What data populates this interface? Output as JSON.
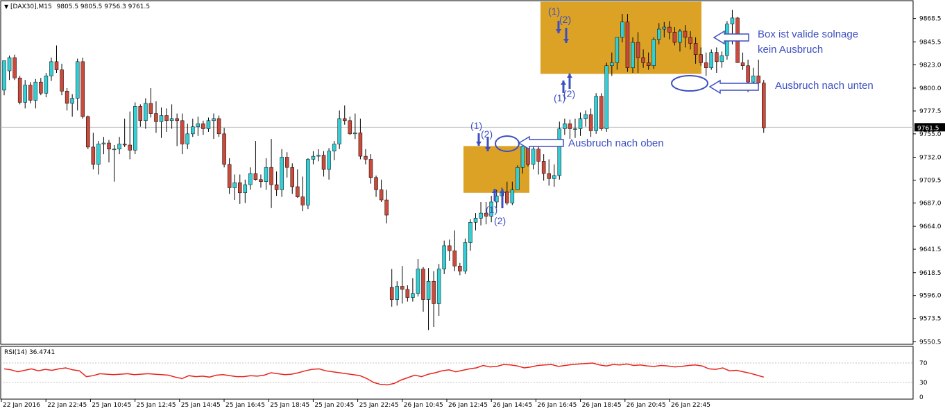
{
  "header": {
    "symbol": "[DAX30],M15",
    "ohlc": "9805.5 9805.5 9756.3 9761.5"
  },
  "rsi": {
    "label": "RSI(14) 36.4741"
  },
  "colors": {
    "bull": "#32cfd6",
    "bear": "#cb4a3b",
    "wick": "#000000",
    "box": "#dba226",
    "annotation": "#3d4fc2",
    "rsi_line": "#e8231c",
    "grid_line": "#c0c0c0"
  },
  "annotations": {
    "box_valid_1": "Box ist valide solnage",
    "box_valid_2": "kein Ausbruch",
    "breakout_down": "Ausbruch nach unten",
    "breakout_up": "Ausbruch nach oben",
    "m1": "(1)",
    "m2": "(2)"
  },
  "chart_data": {
    "type": "candlestick",
    "symbol": "[DAX30]",
    "timeframe": "M15",
    "current_price": "9761.5",
    "price_axis_ticks": [
      "9868.5",
      "9845.5",
      "9823.0",
      "9800.0",
      "9777.5",
      "9755.0",
      "9732.0",
      "9709.5",
      "9687.0",
      "9664.0",
      "9641.5",
      "9618.5",
      "9596.0",
      "9573.5",
      "9550.5"
    ],
    "time_axis_labels": [
      "22 Jan 2016",
      "22 Jan 22:45",
      "25 Jan 10:45",
      "25 Jan 12:45",
      "25 Jan 14:45",
      "25 Jan 16:45",
      "25 Jan 18:45",
      "25 Jan 20:45",
      "25 Jan 22:45",
      "26 Jan 10:45",
      "26 Jan 12:45",
      "26 Jan 14:45",
      "26 Jan 16:45",
      "26 Jan 18:45",
      "26 Jan 20:45",
      "26 Jan 22:45"
    ],
    "ylim": [
      9548,
      9886
    ],
    "candles": [
      [
        9798,
        9827,
        9793,
        9827
      ],
      [
        9817,
        9832,
        9808,
        9830
      ],
      [
        9830,
        9833,
        9808,
        9810
      ],
      [
        9810,
        9812,
        9784,
        9786
      ],
      [
        9786,
        9808,
        9780,
        9803
      ],
      [
        9803,
        9806,
        9785,
        9788
      ],
      [
        9788,
        9809,
        9780,
        9806
      ],
      [
        9806,
        9810,
        9793,
        9795
      ],
      [
        9795,
        9815,
        9791,
        9812
      ],
      [
        9812,
        9830,
        9807,
        9826
      ],
      [
        9826,
        9842,
        9815,
        9818
      ],
      [
        9818,
        9824,
        9793,
        9797
      ],
      [
        9797,
        9800,
        9778,
        9785
      ],
      [
        9785,
        9794,
        9772,
        9790
      ],
      [
        9790,
        9829,
        9778,
        9826
      ],
      [
        9826,
        9830,
        9770,
        9772
      ],
      [
        9772,
        9773,
        9740,
        9742
      ],
      [
        9742,
        9756,
        9720,
        9725
      ],
      [
        9725,
        9748,
        9715,
        9745
      ],
      [
        9745,
        9752,
        9735,
        9746
      ],
      [
        9746,
        9749,
        9727,
        9740
      ],
      [
        9740,
        9744,
        9708,
        9740
      ],
      [
        9740,
        9752,
        9735,
        9745
      ],
      [
        9745,
        9770,
        9742,
        9744
      ],
      [
        9744,
        9777,
        9730,
        9739
      ],
      [
        9739,
        9786,
        9735,
        9782
      ],
      [
        9782,
        9784,
        9762,
        9768
      ],
      [
        9768,
        9790,
        9760,
        9785
      ],
      [
        9785,
        9800,
        9771,
        9775
      ],
      [
        9775,
        9787,
        9756,
        9767
      ],
      [
        9767,
        9781,
        9751,
        9773
      ],
      [
        9773,
        9780,
        9757,
        9768
      ],
      [
        9768,
        9784,
        9760,
        9770
      ],
      [
        9770,
        9775,
        9743,
        9768
      ],
      [
        9768,
        9775,
        9735,
        9745
      ],
      [
        9745,
        9765,
        9740,
        9755
      ],
      [
        9755,
        9770,
        9752,
        9762
      ],
      [
        9762,
        9772,
        9753,
        9765
      ],
      [
        9765,
        9768,
        9754,
        9760
      ],
      [
        9760,
        9771,
        9757,
        9768
      ],
      [
        9768,
        9775,
        9750,
        9770
      ],
      [
        9770,
        9773,
        9752,
        9755
      ],
      [
        9755,
        9761,
        9722,
        9725
      ],
      [
        9725,
        9731,
        9696,
        9702
      ],
      [
        9702,
        9715,
        9690,
        9707
      ],
      [
        9707,
        9715,
        9686,
        9697
      ],
      [
        9697,
        9710,
        9687,
        9705
      ],
      [
        9705,
        9722,
        9700,
        9716
      ],
      [
        9716,
        9748,
        9709,
        9710
      ],
      [
        9710,
        9715,
        9702,
        9708
      ],
      [
        9708,
        9731,
        9700,
        9722
      ],
      [
        9722,
        9750,
        9682,
        9705
      ],
      [
        9705,
        9718,
        9694,
        9700
      ],
      [
        9700,
        9740,
        9693,
        9732
      ],
      [
        9732,
        9737,
        9712,
        9722
      ],
      [
        9722,
        9726,
        9696,
        9703
      ],
      [
        9703,
        9720,
        9692,
        9693
      ],
      [
        9693,
        9713,
        9679,
        9685
      ],
      [
        9685,
        9731,
        9681,
        9730
      ],
      [
        9730,
        9738,
        9725,
        9733
      ],
      [
        9733,
        9740,
        9728,
        9734
      ],
      [
        9734,
        9738,
        9713,
        9720
      ],
      [
        9720,
        9741,
        9710,
        9738
      ],
      [
        9738,
        9748,
        9729,
        9745
      ],
      [
        9745,
        9778,
        9740,
        9770
      ],
      [
        9770,
        9783,
        9764,
        9768
      ],
      [
        9768,
        9772,
        9754,
        9755
      ],
      [
        9755,
        9775,
        9750,
        9756
      ],
      [
        9756,
        9770,
        9730,
        9733
      ],
      [
        9733,
        9740,
        9725,
        9730
      ],
      [
        9730,
        9735,
        9706,
        9712
      ],
      [
        9712,
        9714,
        9693,
        9700
      ],
      [
        9700,
        9710,
        9688,
        9690
      ],
      [
        9690,
        9700,
        9667,
        9675
      ],
      [
        9604,
        9622,
        9585,
        9592
      ],
      [
        9592,
        9610,
        9586,
        9605
      ],
      [
        9605,
        9625,
        9588,
        9602
      ],
      [
        9602,
        9606,
        9590,
        9594
      ],
      [
        9594,
        9613,
        9590,
        9598
      ],
      [
        9598,
        9632,
        9595,
        9622
      ],
      [
        9622,
        9624,
        9580,
        9592
      ],
      [
        9592,
        9623,
        9562,
        9610
      ],
      [
        9610,
        9620,
        9565,
        9588
      ],
      [
        9588,
        9627,
        9576,
        9622
      ],
      [
        9622,
        9650,
        9617,
        9645
      ],
      [
        9645,
        9651,
        9630,
        9640
      ],
      [
        9640,
        9660,
        9620,
        9625
      ],
      [
        9625,
        9628,
        9616,
        9620
      ],
      [
        9620,
        9652,
        9617,
        9648
      ],
      [
        9648,
        9671,
        9640,
        9668
      ],
      [
        9668,
        9677,
        9660,
        9672
      ],
      [
        9672,
        9688,
        9665,
        9677
      ],
      [
        9677,
        9688,
        9666,
        9674
      ],
      [
        9674,
        9694,
        9668,
        9688
      ],
      [
        9688,
        9700,
        9682,
        9694
      ],
      [
        9694,
        9702,
        9688,
        9698
      ],
      [
        9698,
        9708,
        9685,
        9687
      ],
      [
        9687,
        9708,
        9685,
        9700
      ],
      [
        9700,
        9724,
        9700,
        9722
      ],
      [
        9722,
        9747,
        9716,
        9743
      ],
      [
        9743,
        9748,
        9723,
        9725
      ],
      [
        9725,
        9750,
        9720,
        9740
      ],
      [
        9740,
        9746,
        9715,
        9728
      ],
      [
        9728,
        9735,
        9709,
        9716
      ],
      [
        9716,
        9730,
        9704,
        9711
      ],
      [
        9711,
        9725,
        9703,
        9714
      ],
      [
        9714,
        9767,
        9710,
        9760
      ],
      [
        9760,
        9770,
        9754,
        9765
      ],
      [
        9765,
        9769,
        9750,
        9760
      ],
      [
        9760,
        9770,
        9751,
        9760
      ],
      [
        9760,
        9776,
        9753,
        9770
      ],
      [
        9770,
        9778,
        9762,
        9774
      ],
      [
        9774,
        9780,
        9752,
        9758
      ],
      [
        9758,
        9795,
        9755,
        9792
      ],
      [
        9792,
        9795,
        9758,
        9760
      ],
      [
        9760,
        9825,
        9757,
        9822
      ],
      [
        9822,
        9835,
        9812,
        9825
      ],
      [
        9825,
        9849,
        9818,
        9850
      ],
      [
        9850,
        9873,
        9845,
        9865
      ],
      [
        9865,
        9873,
        9816,
        9820
      ],
      [
        9820,
        9850,
        9815,
        9845
      ],
      [
        9845,
        9855,
        9815,
        9830
      ],
      [
        9830,
        9838,
        9820,
        9825
      ],
      [
        9825,
        9835,
        9818,
        9822
      ],
      [
        9822,
        9850,
        9819,
        9848
      ],
      [
        9848,
        9864,
        9843,
        9858
      ],
      [
        9858,
        9865,
        9850,
        9860
      ],
      [
        9860,
        9866,
        9848,
        9855
      ],
      [
        9855,
        9860,
        9842,
        9845
      ],
      [
        9845,
        9858,
        9836,
        9856
      ],
      [
        9856,
        9862,
        9840,
        9850
      ],
      [
        9850,
        9856,
        9838,
        9844
      ],
      [
        9844,
        9850,
        9824,
        9833
      ],
      [
        9833,
        9840,
        9822,
        9825
      ],
      [
        9825,
        9835,
        9812,
        9820
      ],
      [
        9820,
        9838,
        9818,
        9835
      ],
      [
        9835,
        9840,
        9815,
        9826
      ],
      [
        9826,
        9836,
        9820,
        9832
      ],
      [
        9832,
        9866,
        9828,
        9863
      ],
      [
        9863,
        9877,
        9843,
        9869
      ],
      [
        9869,
        9870,
        9840,
        9825
      ],
      [
        9825,
        9835,
        9818,
        9822
      ],
      [
        9822,
        9828,
        9796,
        9806
      ],
      [
        9806,
        9820,
        9800,
        9812
      ],
      [
        9812,
        9828,
        9802,
        9805
      ],
      [
        9805,
        9808,
        9756,
        9761
      ]
    ],
    "rsi": {
      "label": "RSI(14)",
      "value": 36.4741,
      "period": 14,
      "ylim": [
        0,
        100
      ],
      "levels": [
        30,
        70
      ],
      "ticks": [
        "70",
        "30",
        "0"
      ],
      "values": [
        58,
        56,
        52,
        55,
        58,
        54,
        57,
        55,
        58,
        60,
        56,
        54,
        42,
        44,
        48,
        47,
        46,
        47,
        48,
        46,
        47,
        48,
        47,
        46,
        45,
        41,
        38,
        44,
        42,
        43,
        41,
        45,
        46,
        44,
        42,
        42,
        44,
        43,
        45,
        50,
        48,
        46,
        47,
        50,
        54,
        57,
        58,
        54,
        52,
        50,
        48,
        46,
        44,
        38,
        30,
        26,
        25,
        28,
        35,
        40,
        45,
        42,
        47,
        50,
        54,
        56,
        52,
        55,
        58,
        60,
        65,
        62,
        63,
        67,
        66,
        64,
        60,
        62,
        65,
        66,
        67,
        63,
        65,
        67,
        68,
        69,
        70,
        66,
        64,
        67,
        66,
        68,
        65,
        66,
        64,
        63,
        65,
        64,
        62,
        63,
        65,
        66,
        64,
        58,
        57,
        60,
        54,
        55,
        52,
        49,
        45,
        41
      ]
    }
  }
}
